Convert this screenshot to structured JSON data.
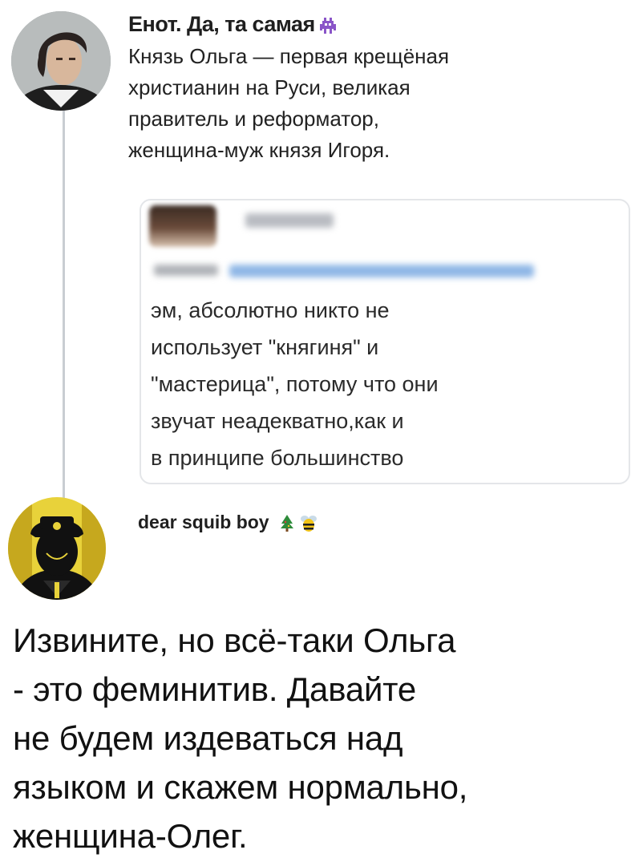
{
  "post1": {
    "author": "Енот. Да, та самая",
    "author_emoji": "alien-monster-icon",
    "lines": [
      "Князь Ольга — первая крещёная",
      "христианин на Руси, великая",
      "правитель и реформатор,",
      "женщина-муж князя Игоря."
    ]
  },
  "quote": {
    "lines": [
      "эм, абсолютно никто не",
      "использует \"княгиня\" и",
      "\"мастерица\", потому что они",
      "звучат неадекватно,как и",
      "в принципе большинство"
    ]
  },
  "post2": {
    "author": "dear squib boy",
    "author_emojis": [
      "christmas-tree-icon",
      "bee-icon"
    ],
    "lines": [
      "Извините, но всё-таки Ольга",
      "- это феминитив. Давайте",
      "не будем издеваться над",
      "языком и скажем нормально,",
      "женщина-Олег."
    ]
  }
}
